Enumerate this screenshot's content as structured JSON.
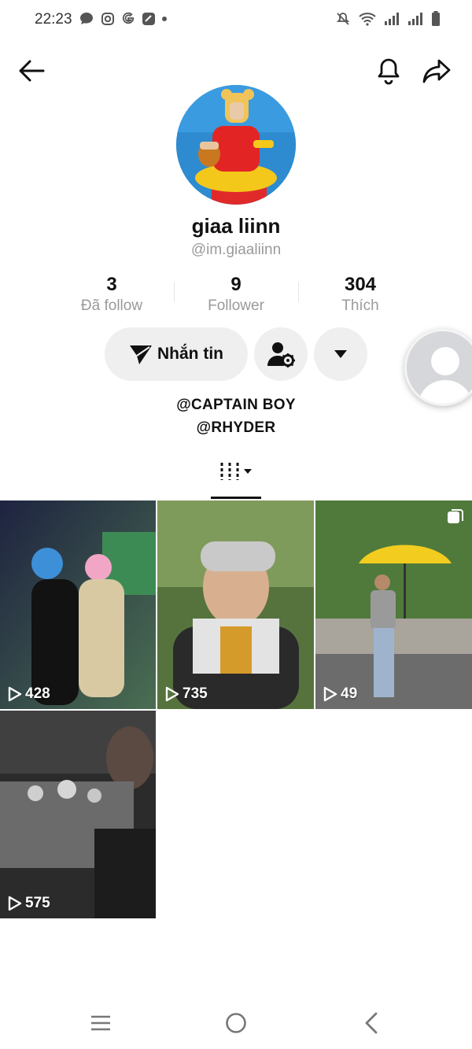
{
  "status": {
    "time": "22:23",
    "left_icons": [
      "message-icon",
      "instagram-icon",
      "google-icon",
      "app-icon",
      "dot-icon"
    ],
    "right_icons": [
      "mute-icon",
      "wifi-icon",
      "signal-icon",
      "signal-icon",
      "battery-icon"
    ]
  },
  "header": {
    "back_icon": "arrow-left-icon",
    "bell_icon": "bell-icon",
    "share_icon": "share-icon"
  },
  "profile": {
    "display_name": "giaa liinn",
    "username": "@im.giaaliinn",
    "stats": [
      {
        "value": "3",
        "label": "Đã follow"
      },
      {
        "value": "9",
        "label": "Follower"
      },
      {
        "value": "304",
        "label": "Thích"
      }
    ],
    "message_label": "Nhắn tin",
    "bio": [
      "@CAPTAIN BOY",
      "@RHYDER"
    ]
  },
  "videos": [
    {
      "views": "428",
      "colors": [
        "#2b2f4a",
        "#4a7ea8",
        "#1a1a1a"
      ]
    },
    {
      "views": "735",
      "colors": [
        "#4d6b3a",
        "#7a9a5a",
        "#2a2a2a"
      ]
    },
    {
      "views": "49",
      "colors": [
        "#3e6a2e",
        "#d9c12b",
        "#7a7a7a"
      ]
    },
    {
      "views": "575",
      "colors": [
        "#2a2a2a",
        "#555555",
        "#777777"
      ]
    }
  ],
  "navbar_icons": [
    "menu-icon",
    "home-circle-icon",
    "back-chevron-icon"
  ]
}
